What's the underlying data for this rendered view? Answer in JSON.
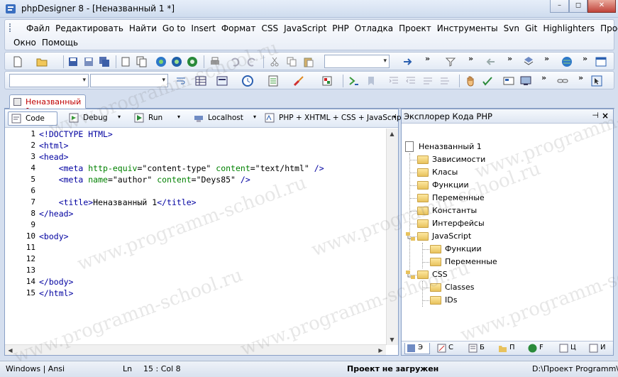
{
  "window": {
    "title": "phpDesigner 8 - [Неназванный 1 *]",
    "controls": {
      "minimize": "–",
      "maximize": "◻",
      "close": "✕"
    }
  },
  "menu": {
    "row1": [
      "Файл",
      "Редактировать",
      "Найти",
      "Go to",
      "Insert",
      "Формат",
      "CSS",
      "JavaScript",
      "PHP",
      "Отладка",
      "Проект",
      "Инструменты",
      "Svn",
      "Git",
      "Highlighters",
      "Просмотр"
    ],
    "row2": [
      "Окно",
      "Помощь"
    ]
  },
  "toolbar_overflow": "»",
  "document_tab": {
    "label": "Неназванный 1"
  },
  "editor_toolbar": {
    "code": "Code",
    "debug": "Debug",
    "run": "Run",
    "localhost": "Localhost",
    "language": "PHP + XHTML + CSS + JavaScript",
    "dropdown": "▾"
  },
  "code_lines": [
    {
      "n": "1",
      "parts": [
        {
          "c": "tag",
          "t": "<!DOCTYPE HTML>"
        }
      ]
    },
    {
      "n": "2",
      "parts": [
        {
          "c": "tag",
          "t": "<html>"
        }
      ]
    },
    {
      "n": "3",
      "parts": [
        {
          "c": "tag",
          "t": "<head>"
        }
      ]
    },
    {
      "n": "4",
      "parts": [
        {
          "c": "",
          "t": "    "
        },
        {
          "c": "tag",
          "t": "<meta "
        },
        {
          "c": "attr",
          "t": "http-equiv"
        },
        {
          "c": "",
          "t": "=\"content-type\" "
        },
        {
          "c": "attr",
          "t": "content"
        },
        {
          "c": "",
          "t": "=\"text/html\" "
        },
        {
          "c": "tag",
          "t": "/>"
        }
      ]
    },
    {
      "n": "5",
      "parts": [
        {
          "c": "",
          "t": "    "
        },
        {
          "c": "tag",
          "t": "<meta "
        },
        {
          "c": "attr",
          "t": "name"
        },
        {
          "c": "",
          "t": "=\"author\" "
        },
        {
          "c": "attr",
          "t": "content"
        },
        {
          "c": "",
          "t": "=\"Deys85\" "
        },
        {
          "c": "tag",
          "t": "/>"
        }
      ]
    },
    {
      "n": "6",
      "parts": []
    },
    {
      "n": "7",
      "parts": [
        {
          "c": "",
          "t": "    "
        },
        {
          "c": "tag",
          "t": "<title>"
        },
        {
          "c": "",
          "t": "Неназванный 1"
        },
        {
          "c": "tag",
          "t": "</title>"
        }
      ]
    },
    {
      "n": "8",
      "parts": [
        {
          "c": "tag",
          "t": "</head>"
        }
      ]
    },
    {
      "n": "9",
      "parts": []
    },
    {
      "n": "10",
      "parts": [
        {
          "c": "tag",
          "t": "<body>"
        }
      ]
    },
    {
      "n": "11",
      "parts": []
    },
    {
      "n": "12",
      "parts": []
    },
    {
      "n": "13",
      "parts": []
    },
    {
      "n": "14",
      "parts": [
        {
          "c": "tag",
          "t": "</body>"
        }
      ]
    },
    {
      "n": "15",
      "parts": [
        {
          "c": "tag",
          "t": "</html>"
        }
      ]
    }
  ],
  "explorer": {
    "title": "Эксплорер Кода PHP",
    "pin": "⊣",
    "close": "×",
    "tree": {
      "root": "Неназванный 1",
      "php_items": [
        "Зависимости",
        "Класы",
        "Функции",
        "Переменные",
        "Константы",
        "Интерфейсы"
      ],
      "javascript": {
        "label": "JavaScript",
        "children": [
          "Функции",
          "Переменные"
        ]
      },
      "css": {
        "label": "CSS",
        "children": [
          "Classes",
          "IDs"
        ]
      }
    },
    "tabs": [
      "Э",
      "С",
      "Б",
      "П",
      "F",
      "Ц",
      "И"
    ]
  },
  "status": {
    "encoding": "Windows | Ansi",
    "ln_label": "Ln",
    "position": "15 : Col   8",
    "project": "Проект не загружен",
    "path": "D:\\Проект Programm\\$"
  },
  "watermark": "www.programm-school.ru",
  "colors": {
    "tag": "#0000a0",
    "attr": "#008000",
    "tab_label": "#c00000"
  }
}
